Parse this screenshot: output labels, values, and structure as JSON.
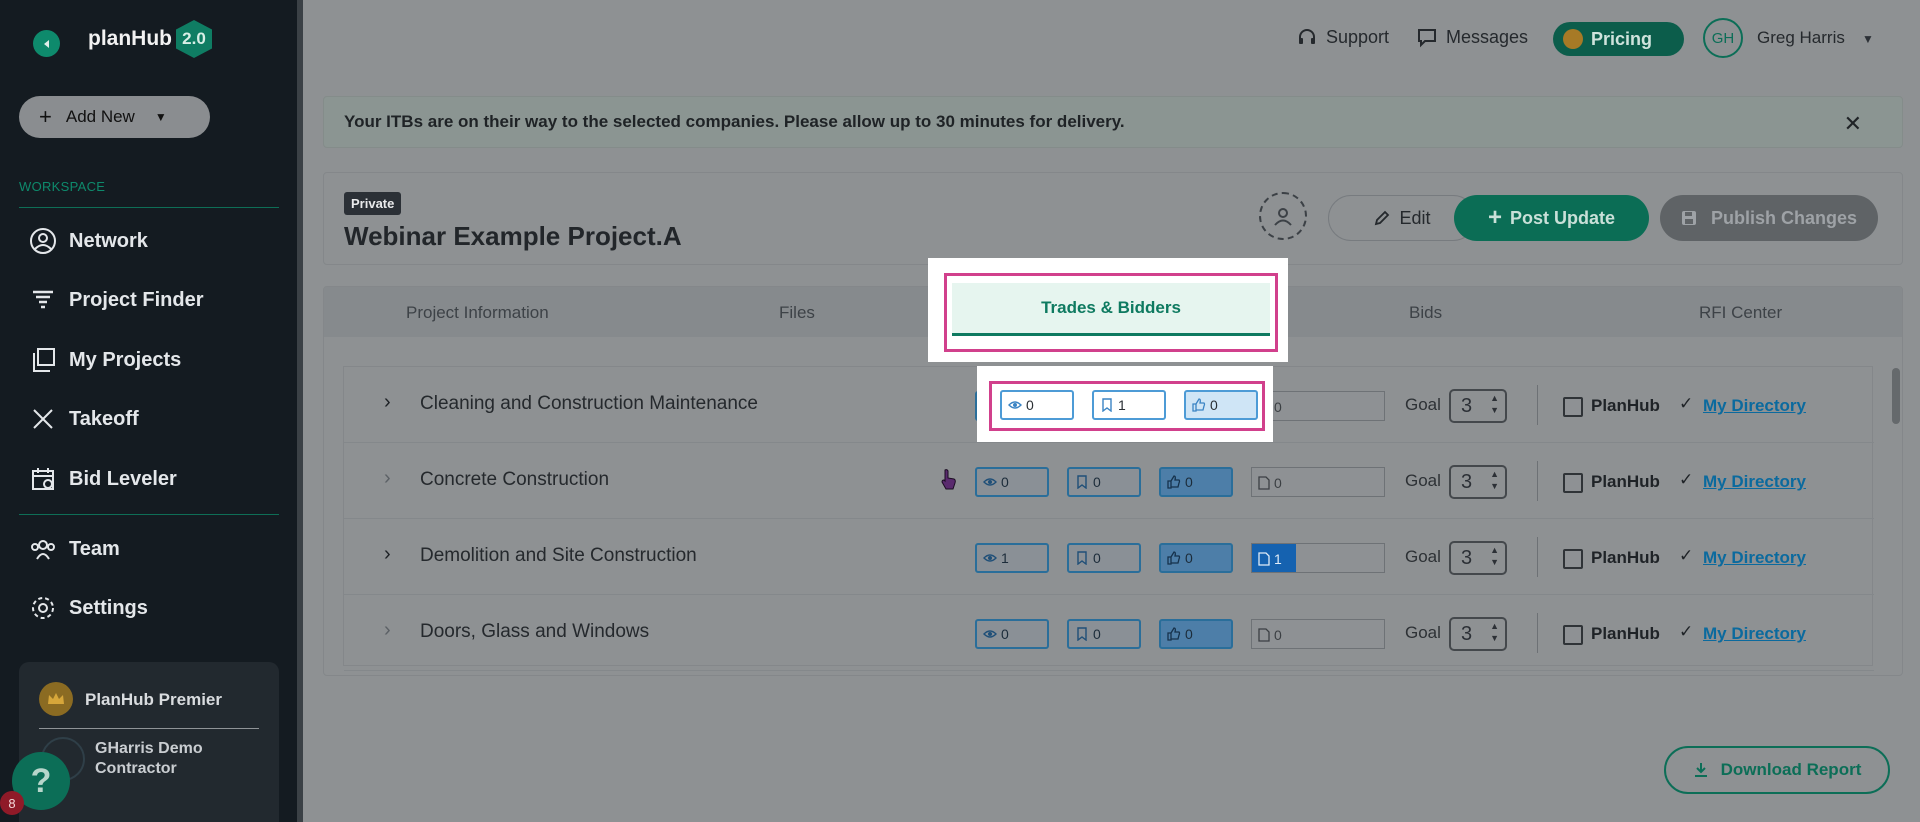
{
  "sidebar": {
    "logo": "planHub",
    "logo_version": "2.0",
    "add_new": "Add New",
    "workspace_label": "WORKSPACE",
    "items": [
      {
        "label": "Network",
        "icon": "user-circle-icon"
      },
      {
        "label": "Project Finder",
        "icon": "funnel-icon"
      },
      {
        "label": "My Projects",
        "icon": "folders-icon"
      },
      {
        "label": "Takeoff",
        "icon": "ruler-pencil-icon"
      },
      {
        "label": "Bid Leveler",
        "icon": "calendar-icon"
      },
      {
        "label": "Team",
        "icon": "team-icon"
      },
      {
        "label": "Settings",
        "icon": "gear-icon"
      }
    ],
    "premier": {
      "title": "PlanHub Premier",
      "org": "GHarris Demo Contractor"
    },
    "help_badge": "8"
  },
  "topbar": {
    "support": "Support",
    "messages": "Messages",
    "pricing": "Pricing",
    "avatar_initials": "GH",
    "user_name": "Greg Harris"
  },
  "banner": {
    "text": "Your ITBs are on their way to the selected companies. Please allow up to 30 minutes for delivery."
  },
  "project": {
    "badge": "Private",
    "title": "Webinar Example Project.A",
    "edit": "Edit",
    "post_update": "Post Update",
    "publish": "Publish Changes"
  },
  "tabs": [
    "Project Information",
    "Files",
    "Trades & Bidders",
    "Bids",
    "RFI Center"
  ],
  "active_tab": "Trades & Bidders",
  "trades": [
    {
      "name": "Cleaning and Construction Maintenance",
      "views": "0",
      "saves": "1",
      "likes": "0",
      "docs": "0",
      "docs_filled": 0,
      "goal": "3",
      "expanded": true
    },
    {
      "name": "Concrete Construction",
      "views": "0",
      "saves": "0",
      "likes": "0",
      "docs": "0",
      "docs_filled": 0,
      "goal": "3",
      "expanded": false
    },
    {
      "name": "Demolition and Site Construction",
      "views": "1",
      "saves": "0",
      "likes": "0",
      "docs": "1",
      "docs_filled": 1,
      "goal": "3",
      "expanded": true
    },
    {
      "name": "Doors, Glass and Windows",
      "views": "0",
      "saves": "0",
      "likes": "0",
      "docs": "0",
      "docs_filled": 0,
      "goal": "3",
      "expanded": false
    }
  ],
  "row_labels": {
    "goal": "Goal",
    "planhub": "PlanHub",
    "my_directory": "My Directory"
  },
  "download": "Download Report",
  "colors": {
    "brand": "#0c6e57",
    "highlight": "#d1408c",
    "link": "#0b6a9e"
  }
}
